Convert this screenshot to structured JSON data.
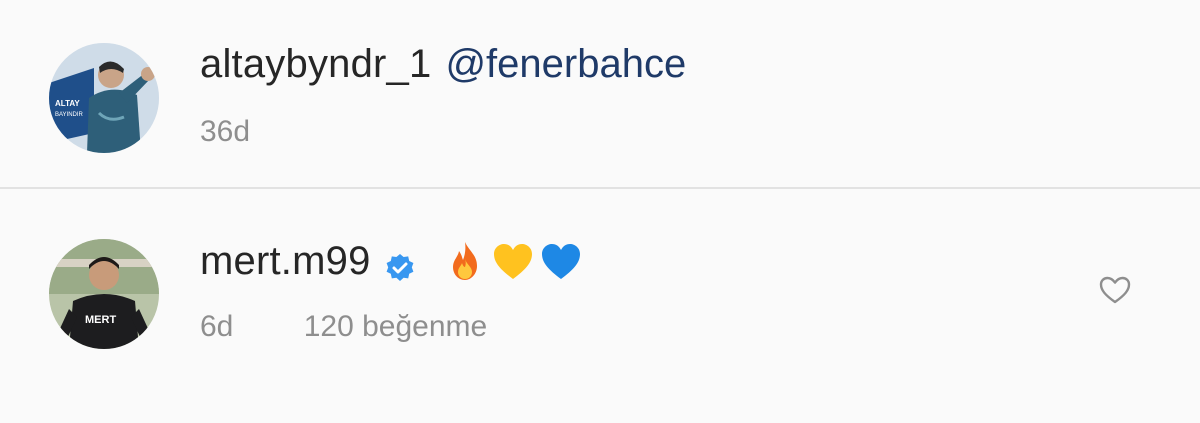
{
  "comments": [
    {
      "username": "altaybyndr_1",
      "text": "@fenerbahce",
      "time": "36d",
      "avatar_lettering": "ALTAY BAYINDIR"
    },
    {
      "username": "mert.m99",
      "verified": true,
      "emojis": [
        "fire-emoji",
        "yellow-heart-emoji",
        "blue-heart-emoji"
      ],
      "time": "6d",
      "likes": "120 beğenme",
      "avatar_lettering": "MERT"
    }
  ],
  "icons": {
    "verified": "verified-badge-icon",
    "like": "heart-outline-icon"
  },
  "colors": {
    "background": "#fafafa",
    "text": "#262626",
    "secondary": "#8e8e8e",
    "mention": "#1f3a68",
    "verified": "#3897f0",
    "divider": "#e2e2e2"
  }
}
